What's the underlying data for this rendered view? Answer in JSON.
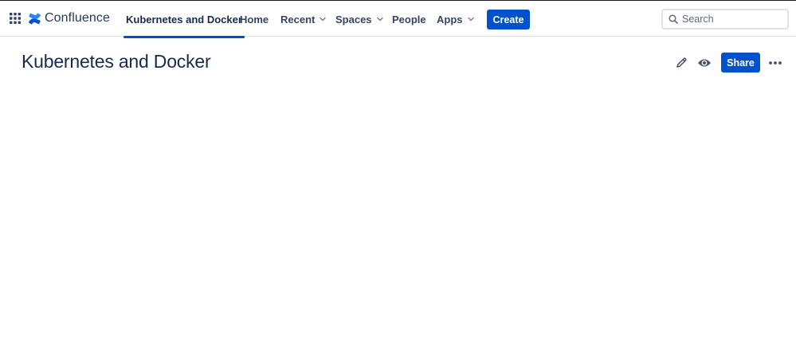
{
  "header": {
    "app_switcher_icon": "grid-icon",
    "logo": {
      "icon": "confluence-logo-icon",
      "text": "Confluence",
      "color": "#0052CC"
    },
    "nav": [
      {
        "label": "Kubernetes and Docker",
        "active": true,
        "dropdown": false
      },
      {
        "label": "Home",
        "active": false,
        "dropdown": false
      },
      {
        "label": "Recent",
        "active": false,
        "dropdown": true
      },
      {
        "label": "Spaces",
        "active": false,
        "dropdown": true
      },
      {
        "label": "People",
        "active": false,
        "dropdown": false
      },
      {
        "label": "Apps",
        "active": false,
        "dropdown": true
      }
    ],
    "create_label": "Create",
    "search": {
      "placeholder": "Search",
      "value": "",
      "icon": "search-icon"
    }
  },
  "page": {
    "title": "Kubernetes and Docker",
    "actions": {
      "edit_icon": "pencil-icon",
      "watch_icon": "eye-icon",
      "share_label": "Share",
      "more_icon": "more-horizontal-icon"
    }
  },
  "colors": {
    "accent": "#0052CC",
    "text": "#172B4D",
    "nav_text": "#344563",
    "border": "#DFE1E6"
  }
}
